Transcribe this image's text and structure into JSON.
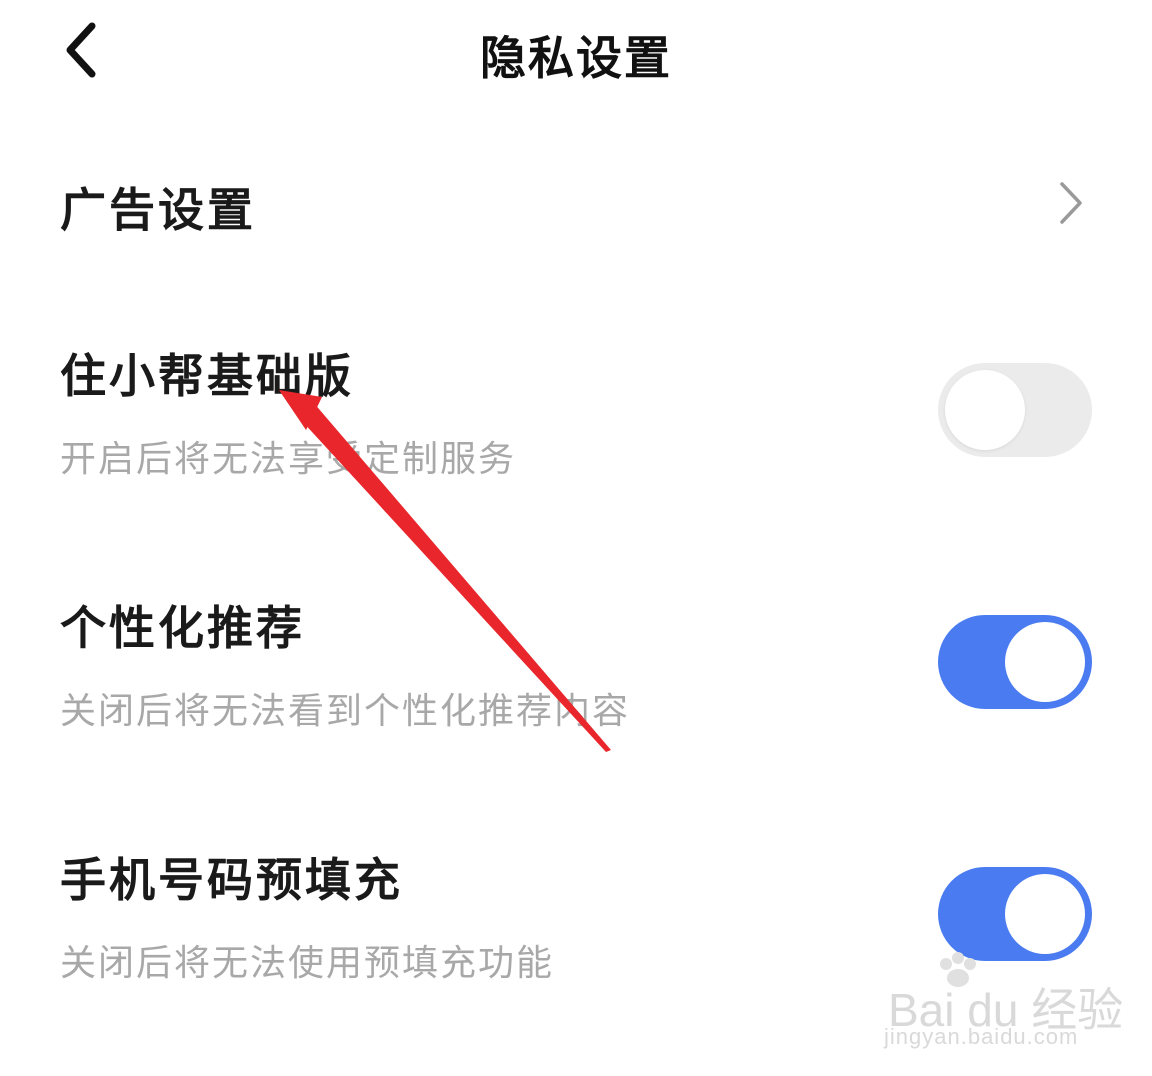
{
  "header": {
    "title": "隐私设置",
    "back_icon": "chevron-left-icon"
  },
  "rows": [
    {
      "title": "广告设置",
      "control": "chevron-right-icon"
    },
    {
      "title": "住小帮基础版",
      "subtitle": "开启后将无法享受定制服务",
      "toggle_on": false
    },
    {
      "title": "个性化推荐",
      "subtitle": "关闭后将无法看到个性化推荐内容",
      "toggle_on": true
    },
    {
      "title": "手机号码预填充",
      "subtitle": "关闭后将无法使用预填充功能",
      "toggle_on": true
    }
  ],
  "colors": {
    "toggle_on": "#4a7bf0",
    "toggle_off": "#ebebeb",
    "annotation_arrow": "#e8262b",
    "subtitle": "#a8a8a8"
  },
  "watermark": {
    "brand": "Bai du 经验",
    "url": "jingyan.baidu.com"
  }
}
